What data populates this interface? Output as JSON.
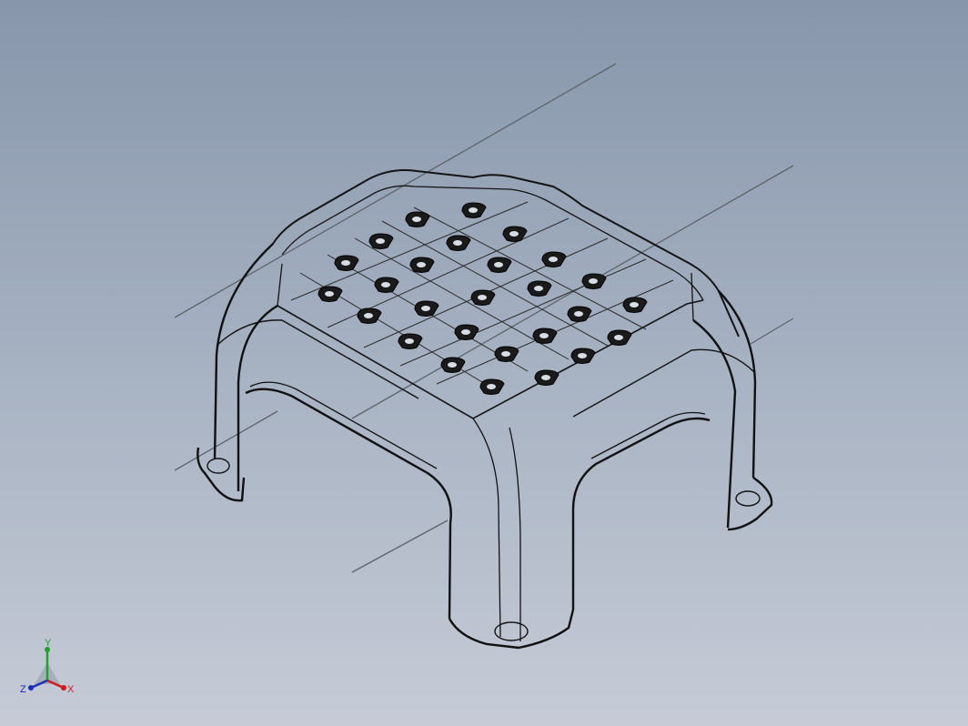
{
  "viewport": {
    "background_top": "#8796ab",
    "background_bottom": "#c6cbd6",
    "render_mode": "wireframe-hidden-lines-visible",
    "model": "step-stool"
  },
  "triad": {
    "x_label": "X",
    "y_label": "Y",
    "z_label": "Z",
    "x_color": "#d0191e",
    "y_color": "#1fa12c",
    "z_color": "#1d2fb5"
  }
}
